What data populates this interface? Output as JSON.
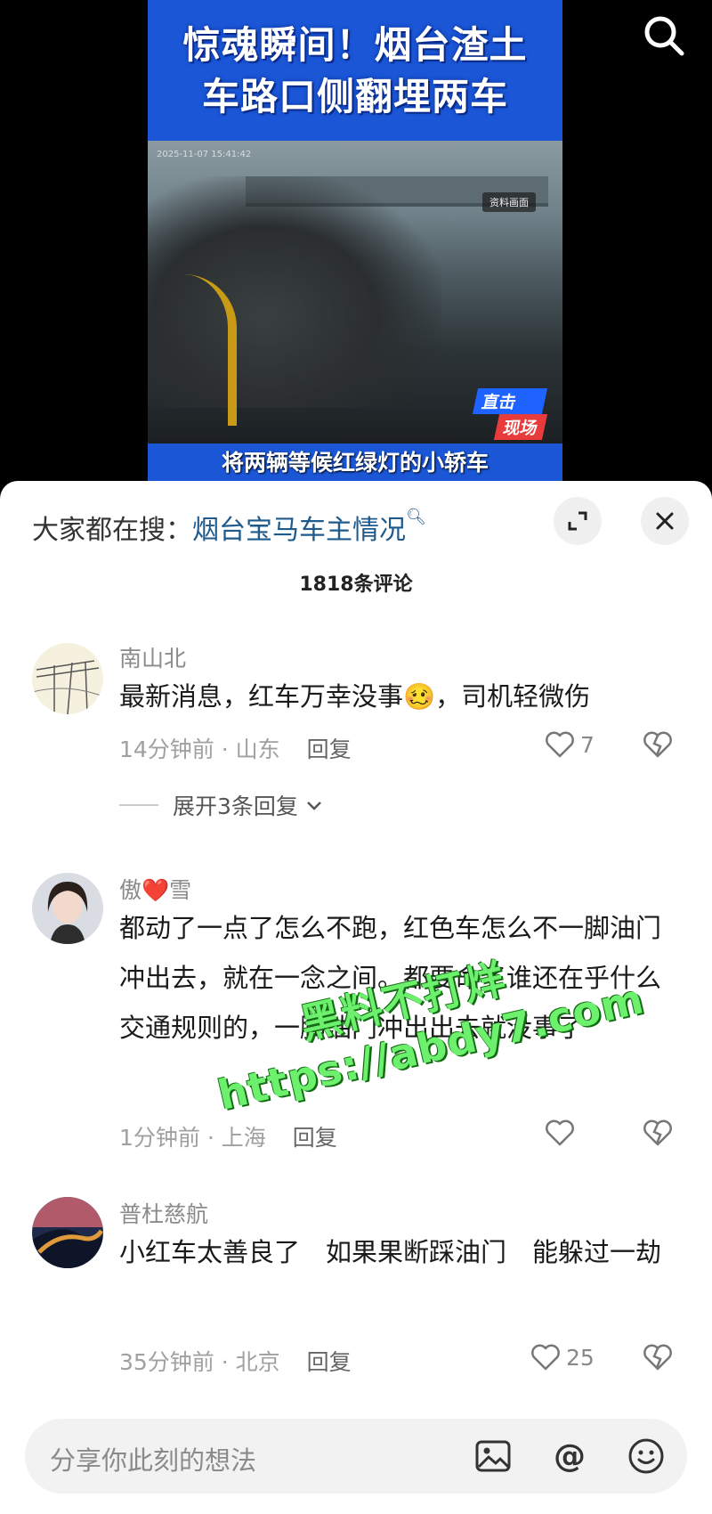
{
  "video": {
    "headline_line1": "惊魂瞬间！烟台渣土",
    "headline_line2": "车路口侧翻埋两车",
    "dashcam_timestamp": "2025-11-07 15:41:42",
    "source_tag": "资料画面",
    "live_badge_line1": "直击",
    "live_badge_line2": "现场",
    "subtitle": "将两辆等候红绿灯的小轿车"
  },
  "trending": {
    "prefix": "大家都在搜：",
    "keyword": "烟台宝马车主情况"
  },
  "comments_count": "1818条评论",
  "comments": [
    {
      "username": "南山北",
      "text": "最新消息，红车万幸没事🥴，司机轻微伤",
      "time_location": "14分钟前 · 山东",
      "reply_label": "回复",
      "likes": "7",
      "expand_label": "展开3条回复"
    },
    {
      "username": "傲❤️雪",
      "text": "都动了一点了怎么不跑，红色车怎么不一脚油门冲出去，就在一念之间。都要命了谁还在乎什么交通规则的，一脚油门冲出出去就没事了",
      "time_location": "1分钟前 · 上海",
      "reply_label": "回复",
      "likes": ""
    },
    {
      "username": "普杜慈航",
      "text": "小红车太善良了　如果果断踩油门　能躲过一劫",
      "time_location": "35分钟前 · 北京",
      "reply_label": "回复",
      "likes": "25"
    }
  ],
  "input": {
    "placeholder": "分享你此刻的想法"
  },
  "watermark": {
    "line1": "黑料不打烊",
    "line2": "https://abdy7.com"
  },
  "colors": {
    "keyword": "#1f5a8c",
    "headline_bg": "#1a56d6",
    "watermark": "#6df06d"
  }
}
